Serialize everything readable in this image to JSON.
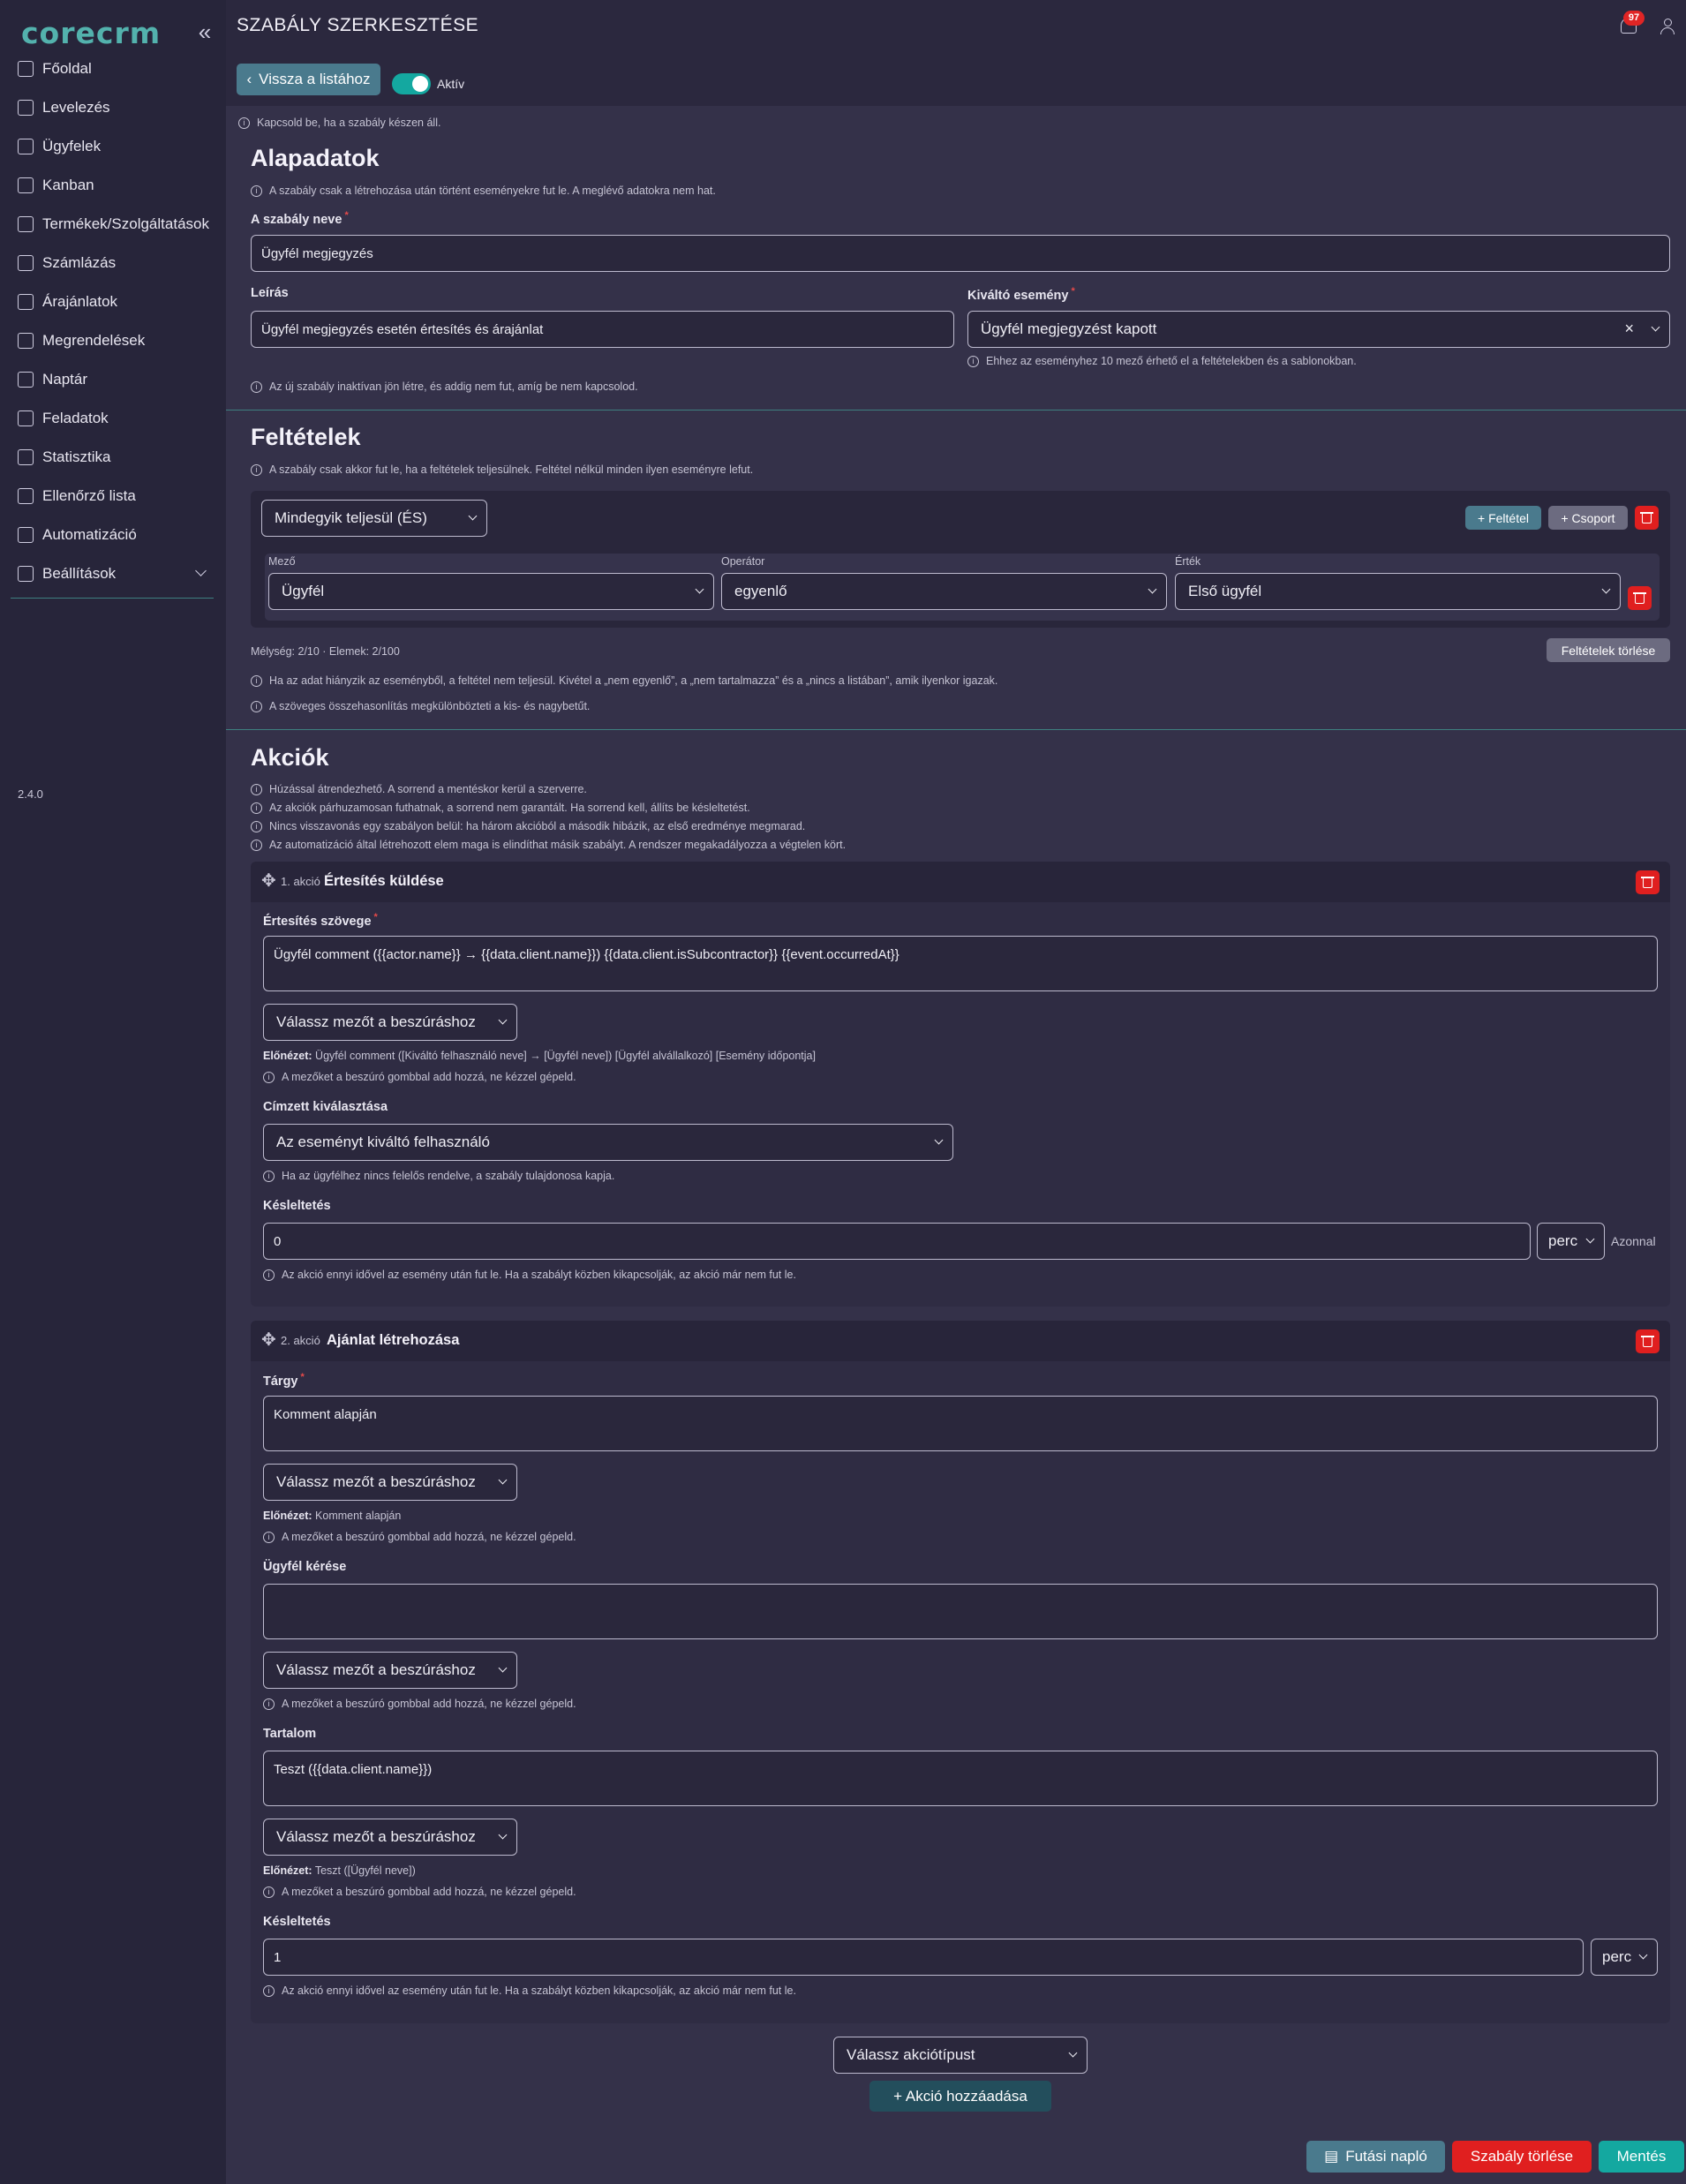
{
  "sidebar": {
    "logo": "corecrm",
    "collapse": "«",
    "version": "2.4.0",
    "items": [
      {
        "label": "Főoldal",
        "icon": "home-icon"
      },
      {
        "label": "Levelezés",
        "icon": "inbox-icon"
      },
      {
        "label": "Ügyfelek",
        "icon": "users-icon"
      },
      {
        "label": "Kanban",
        "icon": "kanban-icon"
      },
      {
        "label": "Termékek/Szolgáltatások",
        "icon": "gear-icon"
      },
      {
        "label": "Számlázás",
        "icon": "invoice-icon"
      },
      {
        "label": "Árajánlatok",
        "icon": "quote-icon"
      },
      {
        "label": "Megrendelések",
        "icon": "order-icon"
      },
      {
        "label": "Naptár",
        "icon": "calendar-icon"
      },
      {
        "label": "Feladatok",
        "icon": "tasks-icon"
      },
      {
        "label": "Statisztika",
        "icon": "chart-icon"
      },
      {
        "label": "Ellenőrző lista",
        "icon": "checklist-icon"
      },
      {
        "label": "Automatizáció",
        "icon": "bolt-icon"
      },
      {
        "label": "Beállítások",
        "icon": "settings-icon"
      }
    ]
  },
  "header": {
    "title": "SZABÁLY SZERKESZTÉSE",
    "notif_count": "97"
  },
  "toolbar": {
    "back": "Vissza a listához",
    "active_label": "Aktív",
    "active_hint": "Kapcsold be, ha a szabály készen áll."
  },
  "basics": {
    "title": "Alapadatok",
    "hint": "A szabály csak a létrehozása után történt eseményekre fut le. A meglévő adatokra nem hat.",
    "name_label": "A szabály neve",
    "name_value": "Ügyfél megjegyzés",
    "desc_label": "Leírás",
    "desc_value": "Ügyfél megjegyzés esetén értesítés és árajánlat",
    "trigger_label": "Kiváltó esemény",
    "trigger_value": "Ügyfél megjegyzést kapott",
    "trigger_clear": "×",
    "trigger_hint": "Ehhez az eseményhez 10 mező érhető el a feltételekben és a sablonokban.",
    "inactive_hint": "Az új szabály inaktívan jön létre, és addig nem fut, amíg be nem kapcsolod."
  },
  "conditions": {
    "title": "Feltételek",
    "hint": "A szabály csak akkor fut le, ha a feltételek teljesülnek. Feltétel nélkül minden ilyen eseményre lefut.",
    "group_mode": "Mindegyik teljesül (ÉS)",
    "add_condition": "+ Feltétel",
    "add_group": "+ Csoport",
    "field_label": "Mező",
    "field_value": "Ügyfél",
    "op_label": "Operátor",
    "op_value": "egyenlő",
    "value_label": "Érték",
    "value_value": "Első ügyfél",
    "depth": "Mélység: 2/10 · Elemek: 2/100",
    "clear": "Feltételek törlése",
    "hint2": "Ha az adat hiányzik az eseményből, a feltétel nem teljesül. Kivétel a „nem egyenlő”, a „nem tartalmazza” és a „nincs a listában”, amik ilyenkor igazak.",
    "hint3": "A szöveges összehasonlítás megkülönbözteti a kis- és nagybetűt."
  },
  "actions": {
    "title": "Akciók",
    "hints": [
      "Húzással átrendezhető. A sorrend a mentéskor kerül a szerverre.",
      "Az akciók párhuzamosan futhatnak, a sorrend nem garantált. Ha sorrend kell, állíts be késleltetést.",
      "Nincs visszavonás egy szabályon belül: ha három akcióból a második hibázik, az első eredménye megmarad.",
      "Az automatizáció által létrehozott elem maga is elindíthat másik szabályt. A rendszer megakadályozza a végtelen kört."
    ],
    "insert_placeholder": "Válassz mezőt a beszúráshoz",
    "insert_hint": "A mezőket a beszúró gombbal add hozzá, ne kézzel gépeld.",
    "preview_label": "Előnézet:",
    "delay_label": "Késleltetés",
    "delay_unit": "perc",
    "delay_hint": "Az akció ennyi idővel az esemény után fut le. Ha a szabályt közben kikapcsolják, az akció már nem fut le.",
    "a1": {
      "num": "1. akció",
      "title": "Értesítés küldése",
      "text_label": "Értesítés szövege",
      "text_value": "Ügyfél comment ({{actor.name}} → {{data.client.name}}) {{data.client.isSubcontractor}} {{event.occurredAt}}",
      "preview": "Ügyfél comment ([Kiváltó felhasználó neve] → [Ügyfél neve]) [Ügyfél alvállalkozó] [Esemény időpontja]",
      "recipient_label": "Címzett kiválasztása",
      "recipient_value": "Az eseményt kiváltó felhasználó",
      "recipient_hint": "Ha az ügyfélhez nincs felelős rendelve, a szabály tulajdonosa kapja.",
      "delay_value": "0",
      "immediate": "Azonnal"
    },
    "a2": {
      "num": "2. akció",
      "title": "Ajánlat létrehozása",
      "subject_label": "Tárgy",
      "subject_value": "Komment alapján",
      "subject_preview": "Komment alapján",
      "request_label": "Ügyfél kérése",
      "request_value": "",
      "content_label": "Tartalom",
      "content_value": "Teszt ({{data.client.name}})",
      "content_preview": "Teszt ([Ügyfél neve])",
      "delay_value": "1"
    },
    "type_placeholder": "Válassz akciótípust",
    "add_action": "+ Akció hozzáadása"
  },
  "footer": {
    "log": "Futási napló",
    "delete": "Szabály törlése",
    "save": "Mentés"
  },
  "colors": {
    "accent": "#14a8a0",
    "danger": "#e01f1f",
    "bg": "#343149",
    "sidebar": "#27253a"
  }
}
